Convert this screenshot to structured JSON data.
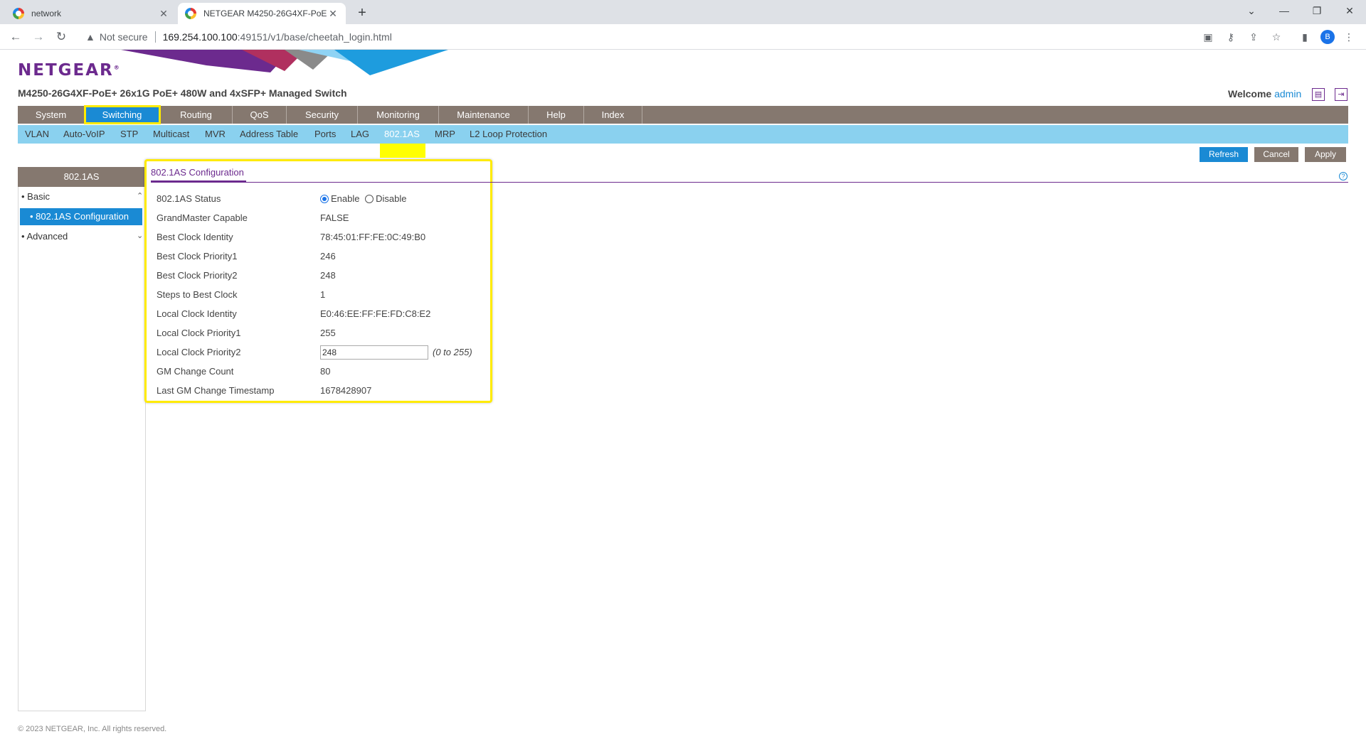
{
  "browser": {
    "tabs": [
      {
        "title": "network",
        "active": false
      },
      {
        "title": "NETGEAR M4250-26G4XF-PoE+",
        "active": true
      }
    ],
    "security_label": "Not secure",
    "url_host": "169.254.100.100",
    "url_path": ":49151/v1/base/cheetah_login.html",
    "profile_initial": "B"
  },
  "header": {
    "logo": "NETGEAR",
    "model": "M4250-26G4XF-PoE+ 26x1G PoE+ 480W and 4xSFP+ Managed Switch",
    "welcome": "Welcome",
    "user": "admin"
  },
  "main_nav": [
    "System",
    "Switching",
    "Routing",
    "QoS",
    "Security",
    "Monitoring",
    "Maintenance",
    "Help",
    "Index"
  ],
  "main_nav_active": "Switching",
  "sub_nav": [
    "VLAN",
    "Auto-VoIP",
    "STP",
    "Multicast",
    "MVR",
    "Address Table",
    "Ports",
    "LAG",
    "802.1AS",
    "MRP",
    "L2 Loop Protection"
  ],
  "sub_nav_active": "802.1AS",
  "buttons": {
    "refresh": "Refresh",
    "cancel": "Cancel",
    "apply": "Apply"
  },
  "sidebar": {
    "title": "802.1AS",
    "basic": "Basic",
    "config": "802.1AS Configuration",
    "advanced": "Advanced"
  },
  "content": {
    "title": "802.1AS Configuration",
    "rows": [
      {
        "label": "802.1AS Status",
        "enable": "Enable",
        "disable": "Disable",
        "selected": "Enable"
      },
      {
        "label": "GrandMaster Capable",
        "value": "FALSE"
      },
      {
        "label": "Best Clock Identity",
        "value": "78:45:01:FF:FE:0C:49:B0"
      },
      {
        "label": "Best Clock Priority1",
        "value": "246"
      },
      {
        "label": "Best Clock Priority2",
        "value": "248"
      },
      {
        "label": "Steps to Best Clock",
        "value": "1"
      },
      {
        "label": "Local Clock Identity",
        "value": "E0:46:EE:FF:FE:FD:C8:E2"
      },
      {
        "label": "Local Clock Priority1",
        "value": "255"
      },
      {
        "label": "Local Clock Priority2",
        "value": "248",
        "range": "(0 to 255)"
      },
      {
        "label": "GM Change Count",
        "value": "80"
      },
      {
        "label": "Last GM Change Timestamp",
        "value": "1678428907"
      }
    ]
  },
  "footer": "© 2023 NETGEAR, Inc. All rights reserved.",
  "colors": {
    "accent_blue": "#1a8ad4",
    "nav_brown": "#85786f",
    "subnav_blue": "#8ad1ef",
    "brand_purple": "#6c2a8e",
    "highlight_yellow": "#ffeb00"
  }
}
